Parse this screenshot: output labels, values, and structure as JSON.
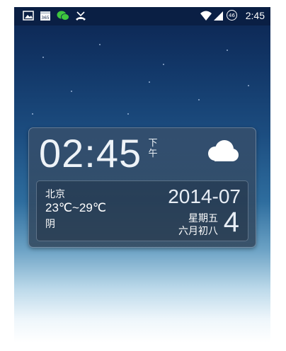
{
  "status_bar": {
    "time": "2:45",
    "network_badge": "46",
    "icons": [
      "image-icon",
      "calendar-icon",
      "wechat-icon",
      "missed-call-icon",
      "wifi-icon",
      "signal-icon",
      "network-badge-icon"
    ]
  },
  "widget": {
    "clock": "02:45",
    "ampm": "下午",
    "weather_icon": "cloud-icon",
    "city": "北京",
    "temperature": "23℃~29℃",
    "condition": "阴",
    "date": "2014-07",
    "weekday": "星期五",
    "lunar_date": "六月初八",
    "day": "4"
  },
  "colors": {
    "status_bar_bg": "#0a1f44",
    "notification_green": "#3ec63e"
  }
}
